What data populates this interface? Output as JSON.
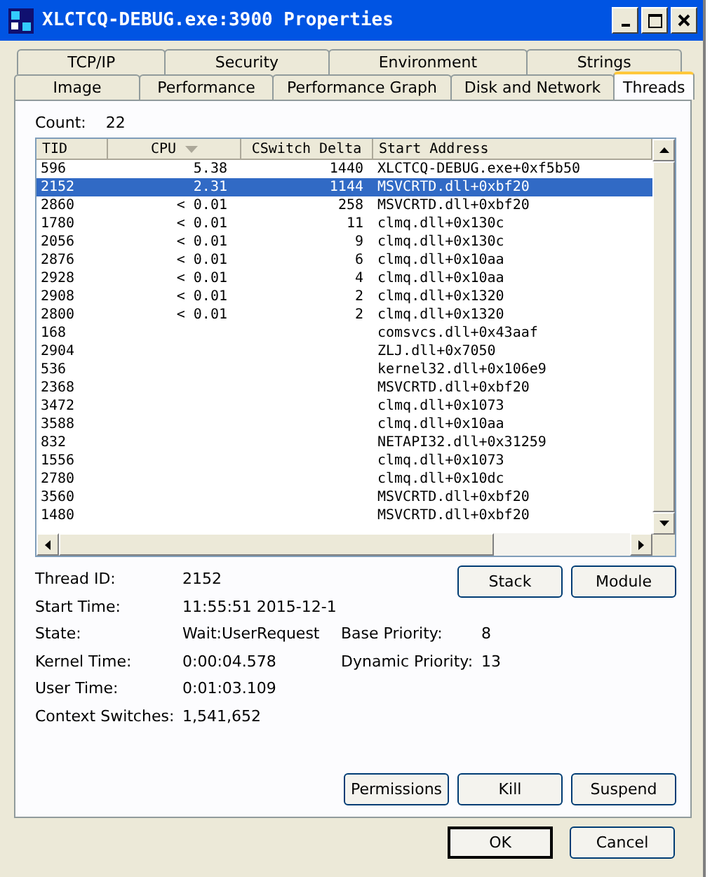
{
  "window": {
    "title": "XLCTCQ-DEBUG.exe:3900 Properties"
  },
  "tab_rows": [
    [
      {
        "label": "TCP/IP",
        "selected": false
      },
      {
        "label": "Security",
        "selected": false
      },
      {
        "label": "Environment",
        "selected": false
      },
      {
        "label": "Strings",
        "selected": false
      }
    ],
    [
      {
        "label": "Image",
        "selected": false
      },
      {
        "label": "Performance",
        "selected": false
      },
      {
        "label": "Performance Graph",
        "selected": false
      },
      {
        "label": "Disk and Network",
        "selected": false
      },
      {
        "label": "Threads",
        "selected": true
      }
    ]
  ],
  "count": {
    "label": "Count:",
    "value": "22"
  },
  "table": {
    "columns": [
      {
        "label": "TID",
        "sorted": false
      },
      {
        "label": "CPU",
        "sorted": true
      },
      {
        "label": "CSwitch Delta",
        "sorted": false
      },
      {
        "label": "Start Address",
        "sorted": false
      }
    ],
    "rows": [
      {
        "tid": "596",
        "cpu": "5.38",
        "cswitch": "1440",
        "address": "XLCTCQ-DEBUG.exe+0xf5b50",
        "selected": false
      },
      {
        "tid": "2152",
        "cpu": "2.31",
        "cswitch": "1144",
        "address": "MSVCRTD.dll+0xbf20",
        "selected": true
      },
      {
        "tid": "2860",
        "cpu": "< 0.01",
        "cswitch": "258",
        "address": "MSVCRTD.dll+0xbf20",
        "selected": false
      },
      {
        "tid": "1780",
        "cpu": "< 0.01",
        "cswitch": "11",
        "address": "clmq.dll+0x130c",
        "selected": false
      },
      {
        "tid": "2056",
        "cpu": "< 0.01",
        "cswitch": "9",
        "address": "clmq.dll+0x130c",
        "selected": false
      },
      {
        "tid": "2876",
        "cpu": "< 0.01",
        "cswitch": "6",
        "address": "clmq.dll+0x10aa",
        "selected": false
      },
      {
        "tid": "2928",
        "cpu": "< 0.01",
        "cswitch": "4",
        "address": "clmq.dll+0x10aa",
        "selected": false
      },
      {
        "tid": "2908",
        "cpu": "< 0.01",
        "cswitch": "2",
        "address": "clmq.dll+0x1320",
        "selected": false
      },
      {
        "tid": "2800",
        "cpu": "< 0.01",
        "cswitch": "2",
        "address": "clmq.dll+0x1320",
        "selected": false
      },
      {
        "tid": "168",
        "address": "comsvcs.dll+0x43aaf",
        "selected": false
      },
      {
        "tid": "2904",
        "address": "ZLJ.dll+0x7050",
        "selected": false
      },
      {
        "tid": "536",
        "address": "kernel32.dll+0x106e9",
        "selected": false
      },
      {
        "tid": "2368",
        "address": "MSVCRTD.dll+0xbf20",
        "selected": false
      },
      {
        "tid": "3472",
        "address": "clmq.dll+0x1073",
        "selected": false
      },
      {
        "tid": "3588",
        "address": "clmq.dll+0x10aa",
        "selected": false
      },
      {
        "tid": "832",
        "address": "NETAPI32.dll+0x31259",
        "selected": false
      },
      {
        "tid": "1556",
        "address": "clmq.dll+0x1073",
        "selected": false
      },
      {
        "tid": "2780",
        "address": "clmq.dll+0x10dc",
        "selected": false
      },
      {
        "tid": "3560",
        "address": "MSVCRTD.dll+0xbf20",
        "selected": false
      },
      {
        "tid": "1480",
        "address": "MSVCRTD.dll+0xbf20",
        "selected": false
      }
    ]
  },
  "details": [
    {
      "label": "Thread ID:",
      "value": "2152"
    },
    {
      "label": "Start Time:",
      "value": "11:55:51   2015-12-1"
    },
    {
      "label": "State:",
      "value": "Wait:UserRequest",
      "label2": "Base Priority:",
      "value2": "8"
    },
    {
      "label": "Kernel Time:",
      "value": "0:00:04.578",
      "label2": "Dynamic Priority:",
      "value2": "13"
    },
    {
      "label": "User Time:",
      "value": "0:01:03.109"
    },
    {
      "label": "Context Switches:",
      "value": "1,541,652"
    }
  ],
  "side_buttons": [
    "Stack",
    "Module"
  ],
  "action_buttons": [
    "Permissions",
    "Kill",
    "Suspend"
  ],
  "dialog_buttons": [
    {
      "label": "OK",
      "default": true
    },
    {
      "label": "Cancel",
      "default": false
    }
  ]
}
